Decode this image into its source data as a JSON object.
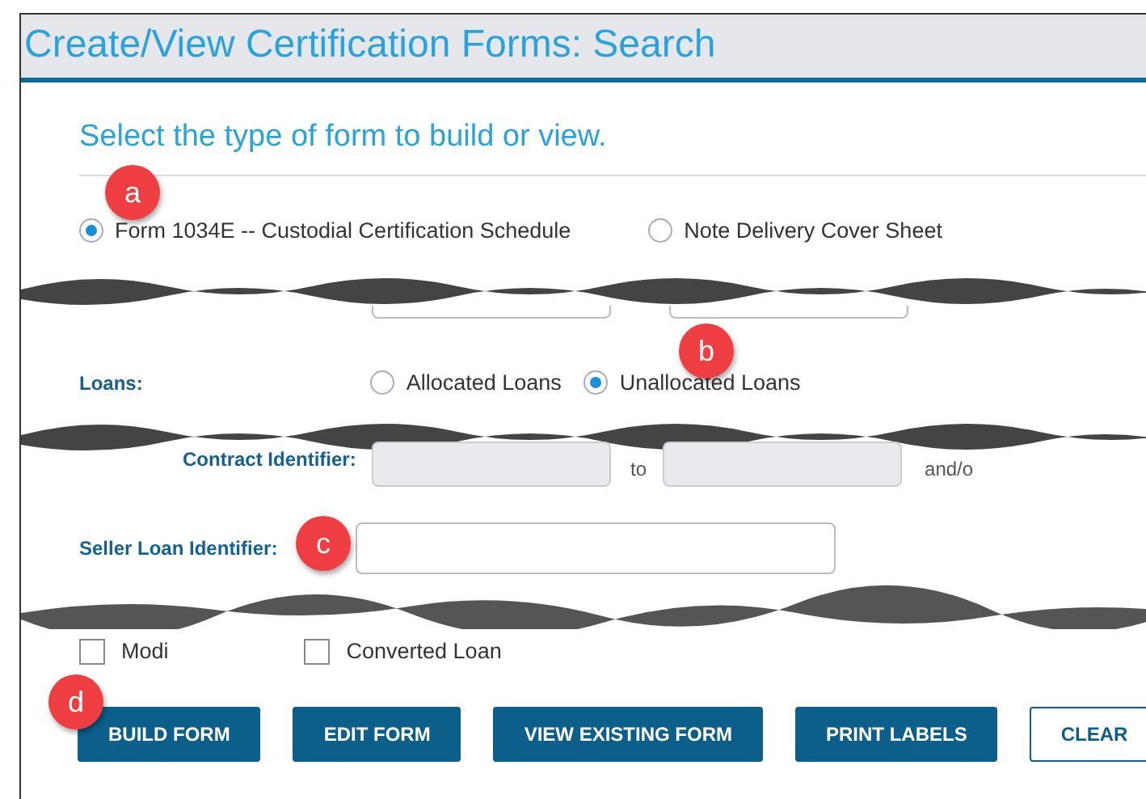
{
  "title": "Create/View Certification Forms: Search",
  "heading": "Select the type of form to build or view.",
  "form_types": [
    {
      "label": "Form 1034E -- Custodial Certification Schedule",
      "selected": true
    },
    {
      "label": "Note Delivery Cover Sheet",
      "selected": false
    }
  ],
  "loans": {
    "label": "Loans:",
    "options": [
      {
        "label": "Allocated Loans",
        "selected": false
      },
      {
        "label": "Unallocated Loans",
        "selected": true
      }
    ]
  },
  "contract": {
    "label": "Contract Identifier:",
    "to": "to",
    "and_or": "and/o"
  },
  "seller": {
    "label": "Seller Loan Identifier:"
  },
  "checkboxes": [
    {
      "label": "Modi",
      "checked": false
    },
    {
      "label": "Converted Loan",
      "checked": false
    }
  ],
  "buttons": [
    {
      "label": "BUILD FORM",
      "kind": "primary"
    },
    {
      "label": "EDIT FORM",
      "kind": "primary"
    },
    {
      "label": "VIEW EXISTING FORM",
      "kind": "primary"
    },
    {
      "label": "PRINT LABELS",
      "kind": "primary"
    },
    {
      "label": "CLEAR",
      "kind": "outline"
    }
  ],
  "callouts": [
    "a",
    "b",
    "c",
    "d"
  ]
}
